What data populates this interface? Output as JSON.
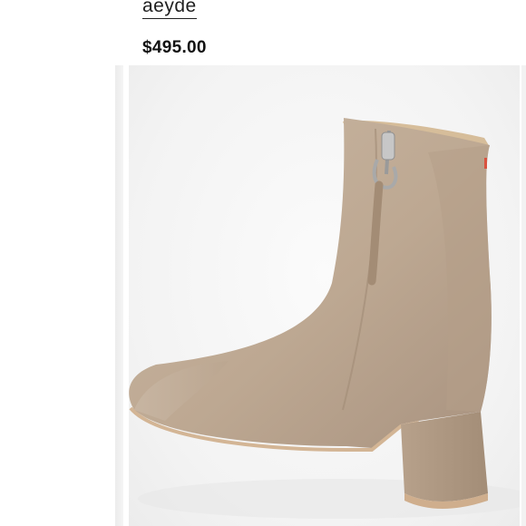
{
  "product": {
    "brand": "aeyde",
    "price": "$495.00"
  },
  "image": {
    "subject": "boot-image",
    "colors": {
      "suede": "#c7b29c",
      "suede_shadow": "#a8927c",
      "lining": "#d9c2a2",
      "sole": "#d8b89a",
      "zipper": "#b8b8b8"
    }
  }
}
